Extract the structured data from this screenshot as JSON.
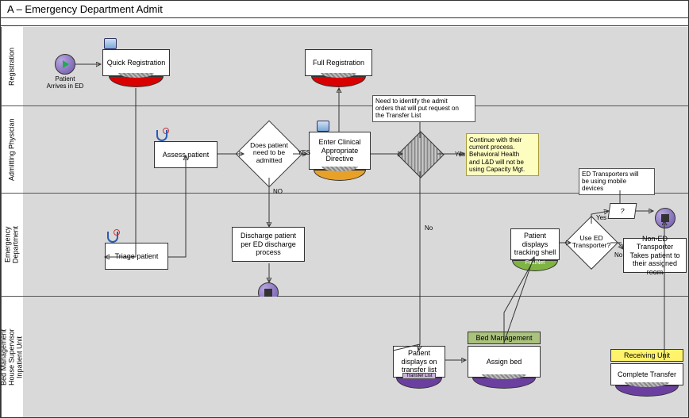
{
  "title": "A – Emergency Department Admit",
  "lanes": {
    "registration": "Registration",
    "admitting_physician": "Admitting Physician",
    "emergency_department": "Emergency\nDepartment",
    "bed_management": "Bed Management\nHouse Supervisor\nInpatient Unit"
  },
  "registration": {
    "start_label": "Patient\nArrives in ED",
    "quick_registration": "Quick Registration",
    "full_registration": "Full Registration"
  },
  "admitting_physician": {
    "assess_patient": "Assess patient",
    "decision_admit": "Does patient\nneed to be\nadmitted",
    "enter_directive": "Enter Clinical\nAppropriate\nDirective",
    "note_admit_orders": "Need to identify the admit\norders that will put request on\nthe Transfer List",
    "note_continue": "Continue with their\ncurrent process.\nBehavioral Health\nand L&D will not be\nusing Capacity Mgt."
  },
  "emergency_department": {
    "triage_patient": "Triage patient",
    "discharge_process": "Discharge patient\nper ED discharge\nprocess",
    "tracking_shell": "Patient\ndisplays\ntracking shell",
    "tracking_system": "FirstNet",
    "decision_transporter": "Use ED\nTransporter?",
    "non_ed_transporter": "Non-ED Transporter\nTakes patient to\ntheir assigned room",
    "note_transporters": "ED Transporters will\nbe using mobile\ndevices",
    "questionmark": "?"
  },
  "bed_management": {
    "transfer_list": "Patient\ndisplays on\ntransfer list",
    "transfer_list_system": "Transfer List",
    "assign_bed": "Assign bed",
    "bed_mgmt_header": "Bed Management",
    "complete_transfer": "Complete Transfer",
    "receiving_unit_header": "Receiving Unit"
  },
  "edge_labels": {
    "yes1": "YES",
    "yes2": "Yes",
    "yes3": "Yes",
    "no1": "NO",
    "no2": "No",
    "no3": "No"
  }
}
